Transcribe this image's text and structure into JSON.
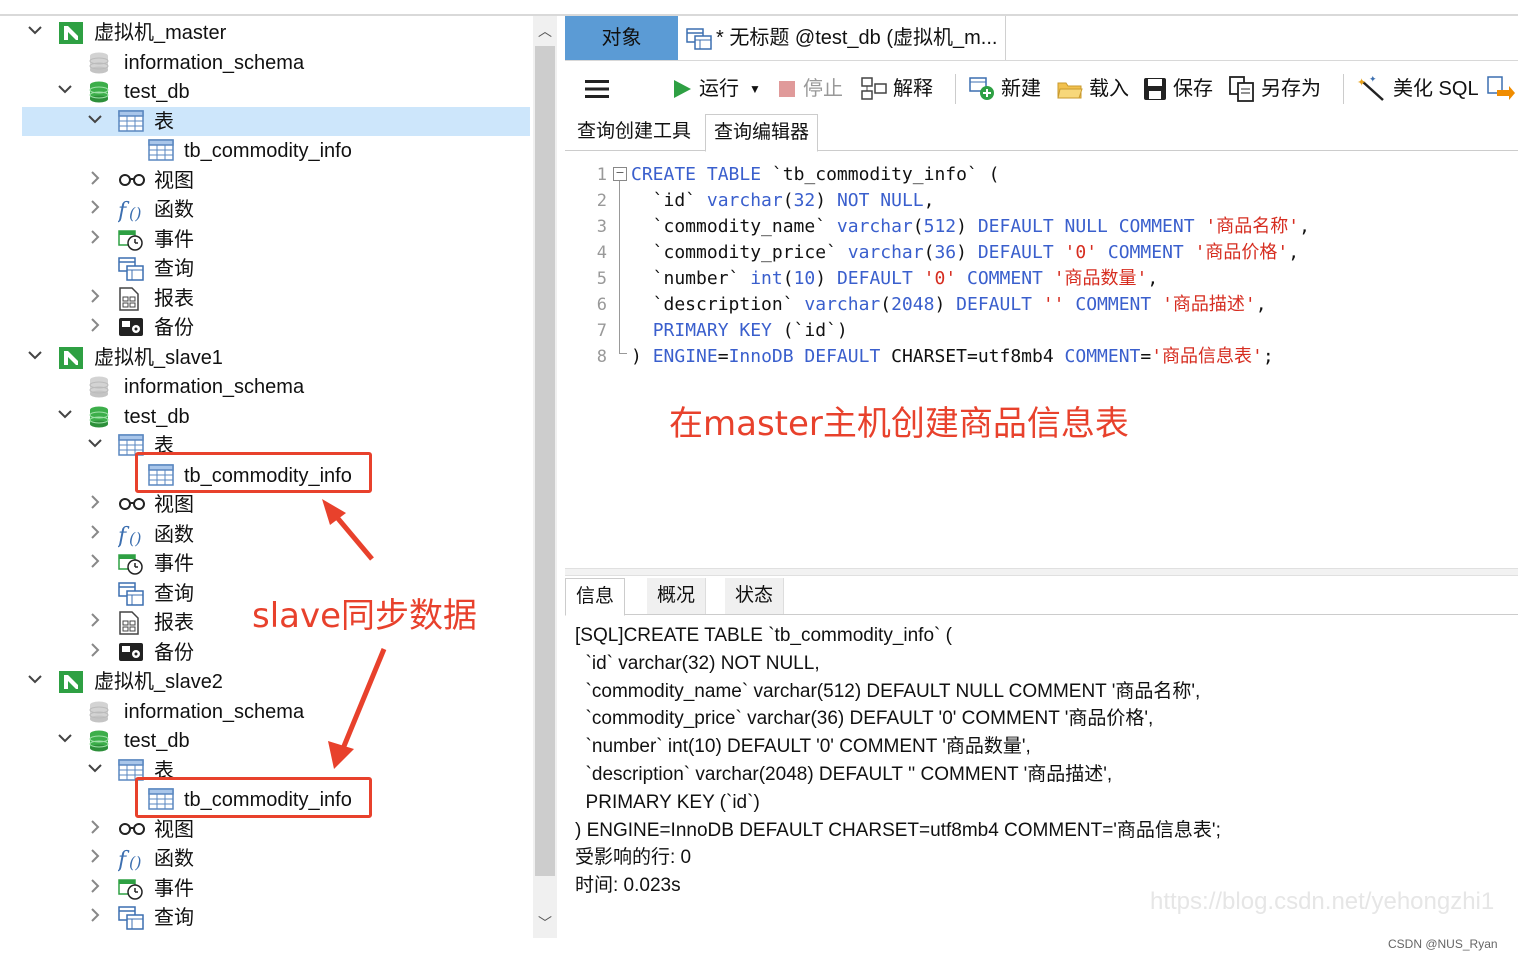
{
  "tree": {
    "rows": [
      {
        "label": "虚拟机_master",
        "icon": "connection-icon",
        "chev": "⌄"
      },
      {
        "label": "information_schema",
        "icon": "database-gray-icon",
        "chev": ""
      },
      {
        "label": "test_db",
        "icon": "database-green-icon",
        "chev": "⌄"
      },
      {
        "label": "表",
        "icon": "table-folder-icon",
        "chev": "⌄"
      },
      {
        "label": "tb_commodity_info",
        "icon": "table-icon",
        "chev": ""
      },
      {
        "label": "视图",
        "icon": "view-icon",
        "chev": "›"
      },
      {
        "label": "函数",
        "icon": "function-icon",
        "chev": "›"
      },
      {
        "label": "事件",
        "icon": "event-icon",
        "chev": "›"
      },
      {
        "label": "查询",
        "icon": "query-icon",
        "chev": ""
      },
      {
        "label": "报表",
        "icon": "report-icon",
        "chev": "›"
      },
      {
        "label": "备份",
        "icon": "backup-icon",
        "chev": "›"
      },
      {
        "label": "虚拟机_slave1",
        "icon": "connection-icon",
        "chev": "⌄"
      },
      {
        "label": "information_schema",
        "icon": "database-gray-icon",
        "chev": ""
      },
      {
        "label": "test_db",
        "icon": "database-green-icon",
        "chev": "⌄"
      },
      {
        "label": "表",
        "icon": "table-folder-icon",
        "chev": "⌄"
      },
      {
        "label": "tb_commodity_info",
        "icon": "table-icon",
        "chev": ""
      },
      {
        "label": "视图",
        "icon": "view-icon",
        "chev": "›"
      },
      {
        "label": "函数",
        "icon": "function-icon",
        "chev": "›"
      },
      {
        "label": "事件",
        "icon": "event-icon",
        "chev": "›"
      },
      {
        "label": "查询",
        "icon": "query-icon",
        "chev": ""
      },
      {
        "label": "报表",
        "icon": "report-icon",
        "chev": "›"
      },
      {
        "label": "备份",
        "icon": "backup-icon",
        "chev": "›"
      },
      {
        "label": "虚拟机_slave2",
        "icon": "connection-icon",
        "chev": "⌄"
      },
      {
        "label": "information_schema",
        "icon": "database-gray-icon",
        "chev": ""
      },
      {
        "label": "test_db",
        "icon": "database-green-icon",
        "chev": "⌄"
      },
      {
        "label": "表",
        "icon": "table-folder-icon",
        "chev": "⌄"
      },
      {
        "label": "tb_commodity_info",
        "icon": "table-icon",
        "chev": ""
      },
      {
        "label": "视图",
        "icon": "view-icon",
        "chev": "›"
      },
      {
        "label": "函数",
        "icon": "function-icon",
        "chev": "›"
      },
      {
        "label": "事件",
        "icon": "event-icon",
        "chev": "›"
      },
      {
        "label": "查询",
        "icon": "query-icon",
        "chev": "›"
      }
    ],
    "selected_index": 3
  },
  "annotations": {
    "slave_sync": "slave同步数据",
    "master_create": "在master主机创建商品信息表"
  },
  "tabs": {
    "objects": "对象",
    "query": "* 无标题 @test_db (虚拟机_m..."
  },
  "toolbar": {
    "run": "运行",
    "stop": "停止",
    "explain": "解释",
    "new": "新建",
    "load": "载入",
    "save": "保存",
    "save_as": "另存为",
    "beautify": "美化 SQL"
  },
  "subtabs": {
    "builder": "查询创建工具",
    "editor": "查询编辑器"
  },
  "editor": {
    "line_numbers": [
      "1",
      "2",
      "3",
      "4",
      "5",
      "6",
      "7",
      "8"
    ]
  },
  "bottom_tabs": {
    "info": "信息",
    "overview": "概况",
    "status": "状态"
  },
  "info_lines": [
    "[SQL]CREATE TABLE `tb_commodity_info` (",
    "  `id` varchar(32) NOT NULL,",
    "  `commodity_name` varchar(512) DEFAULT NULL COMMENT '商品名称',",
    "  `commodity_price` varchar(36) DEFAULT '0' COMMENT '商品价格',",
    "  `number` int(10) DEFAULT '0' COMMENT '商品数量',",
    "  `description` varchar(2048) DEFAULT '' COMMENT '商品描述',",
    "  PRIMARY KEY (`id`)",
    ") ENGINE=InnoDB DEFAULT CHARSET=utf8mb4 COMMENT='商品信息表';",
    "受影响的行: 0",
    "时间: 0.023s"
  ],
  "watermark": "https://blog.csdn.net/yehongzhi1",
  "credit": "CSDN @NUS_Ryan",
  "colors": {
    "accent_tab": "#5b9bd5",
    "selection": "#cde6fb",
    "keyword": "#3a5fcd",
    "string": "#d62d20",
    "annotation": "#e8412c"
  }
}
